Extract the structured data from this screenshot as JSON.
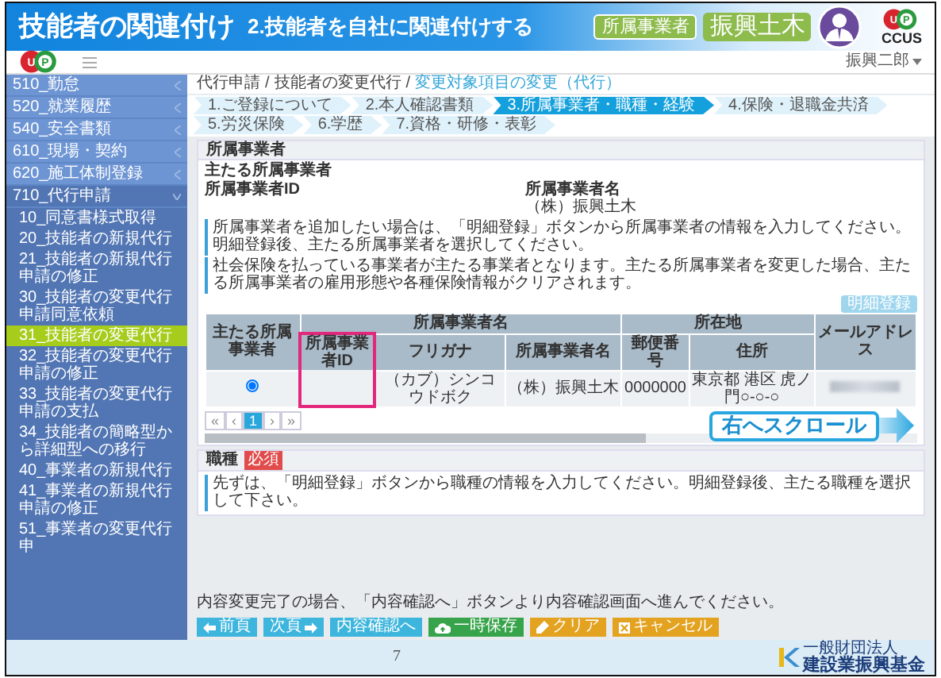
{
  "slide": {
    "title": "技能者の関連付け",
    "subtitle": "2.技能者を自社に関連付けする",
    "affiliation_tag": "所属事業者",
    "affiliation_name": "振興土木",
    "ccus_logo": {
      "letters": [
        "U",
        "P"
      ],
      "caption": "CCUS"
    },
    "page_number": "7",
    "footer_logo": {
      "small": "一般財団法人",
      "name": "建設業振興基金"
    }
  },
  "app": {
    "logo_letters": [
      "U",
      "P"
    ],
    "user": "振興二郎",
    "sidebar": [
      {
        "label": "510_勤怠",
        "expanded": false
      },
      {
        "label": "520_就業履歴",
        "expanded": false
      },
      {
        "label": "540_安全書類",
        "expanded": false
      },
      {
        "label": "610_現場・契約",
        "expanded": false
      },
      {
        "label": "620_施工体制登録",
        "expanded": false
      },
      {
        "label": "710_代行申請",
        "expanded": true,
        "children": [
          {
            "label": "10_同意書様式取得",
            "selected": false
          },
          {
            "label": "20_技能者の新規代行",
            "selected": false
          },
          {
            "label": "21_技能者の新規代行申請の修正",
            "selected": false
          },
          {
            "label": "30_技能者の変更代行申請同意依頼",
            "selected": false
          },
          {
            "label": "31_技能者の変更代行",
            "selected": true
          },
          {
            "label": "32_技能者の変更代行申請の修正",
            "selected": false
          },
          {
            "label": "33_技能者の変更代行申請の支払",
            "selected": false
          },
          {
            "label": "34_技能者の簡略型から詳細型への移行",
            "selected": false
          },
          {
            "label": "40_事業者の新規代行",
            "selected": false
          },
          {
            "label": "41_事業者の新規代行申請の修正",
            "selected": false
          },
          {
            "label": "51_事業者の変更代行申",
            "selected": false
          }
        ]
      }
    ],
    "breadcrumb": [
      {
        "label": "代行申請",
        "kind": "link",
        "current": false
      },
      {
        "label": "/",
        "kind": "separator"
      },
      {
        "label": "技能者の変更代行",
        "kind": "link",
        "current": false
      },
      {
        "label": "/",
        "kind": "separator"
      },
      {
        "label": "変更対象項目の変更（代行）",
        "kind": "link",
        "current": true
      }
    ],
    "steps": [
      {
        "label": "1.ご登録について",
        "selected": false
      },
      {
        "label": "2.本人確認書類",
        "selected": false
      },
      {
        "label": "3.所属事業者・職種・経験",
        "selected": true
      },
      {
        "label": "4.保険・退職金共済",
        "selected": false
      },
      {
        "label": "5.労災保険",
        "selected": false
      },
      {
        "label": "6.学歴",
        "selected": false
      },
      {
        "label": "7.資格・研修・表彰",
        "selected": false
      }
    ],
    "affiliation_card": {
      "title": "所属事業者",
      "main_label": "主たる所属事業者",
      "id_label": "所属事業者ID",
      "name_label": "所属事業者名",
      "name_value": "（株）振興土木",
      "notes": [
        "所属事業者を追加したい場合は、「明細登録」ボタンから所属事業者の情報を入力してください。明細登録後、主たる所属事業者を選択してください。",
        "社会保険を払っている事業者が主たる事業者となります。主たる所属事業者を変更した場合、主たる所属事業者の雇用形態や各種保険情報がクリアされます。"
      ],
      "add_button": "明細登録",
      "table": {
        "headers": [
          {
            "label": "主たる所属事業者"
          },
          {
            "label": "所属事業者名",
            "columns": [
              {
                "label": "所属事業者ID",
                "highlighted": true
              },
              {
                "label": "フリガナ",
                "highlighted": false
              },
              {
                "label": "所属事業者名",
                "highlighted": false
              }
            ]
          },
          {
            "label": "所在地",
            "columns": [
              {
                "label": "郵便番号",
                "highlighted": false
              },
              {
                "label": "住所",
                "highlighted": false
              }
            ]
          },
          {
            "label": "メールアドレス"
          }
        ],
        "rows": [
          {
            "selected": true,
            "furigana": "（カブ）シンコウドボク",
            "name": "（株）振興土木",
            "postal_code": "0000000",
            "address": "東京都 港区 虎ノ門○-○-○",
            "email_redacted": true
          }
        ]
      },
      "pagination": [
        {
          "label": "«",
          "selected": false
        },
        {
          "label": "‹",
          "selected": false
        },
        {
          "label": "1",
          "selected": true
        },
        {
          "label": "›",
          "selected": false
        },
        {
          "label": "»",
          "selected": false
        }
      ],
      "scroll_hint": "右へスクロール"
    },
    "occupation_card": {
      "title": "職種",
      "required_badge": "必須",
      "notes": [
        "先ずは、「明細登録」ボタンから職種の情報を入力してください。明細登録後、主たる職種を選択して下さい。"
      ]
    },
    "footer": {
      "note": "内容変更完了の場合、「内容確認へ」ボタンより内容確認画面へ進んでください。",
      "buttons": [
        {
          "label": "前頁",
          "kind": "back"
        },
        {
          "label": "次頁",
          "kind": "next"
        },
        {
          "label": "内容確認へ",
          "kind": "confirm"
        },
        {
          "label": "一時保存",
          "kind": "save"
        },
        {
          "label": "クリア",
          "kind": "clear"
        },
        {
          "label": "キャンセル",
          "kind": "cancel"
        }
      ]
    }
  }
}
